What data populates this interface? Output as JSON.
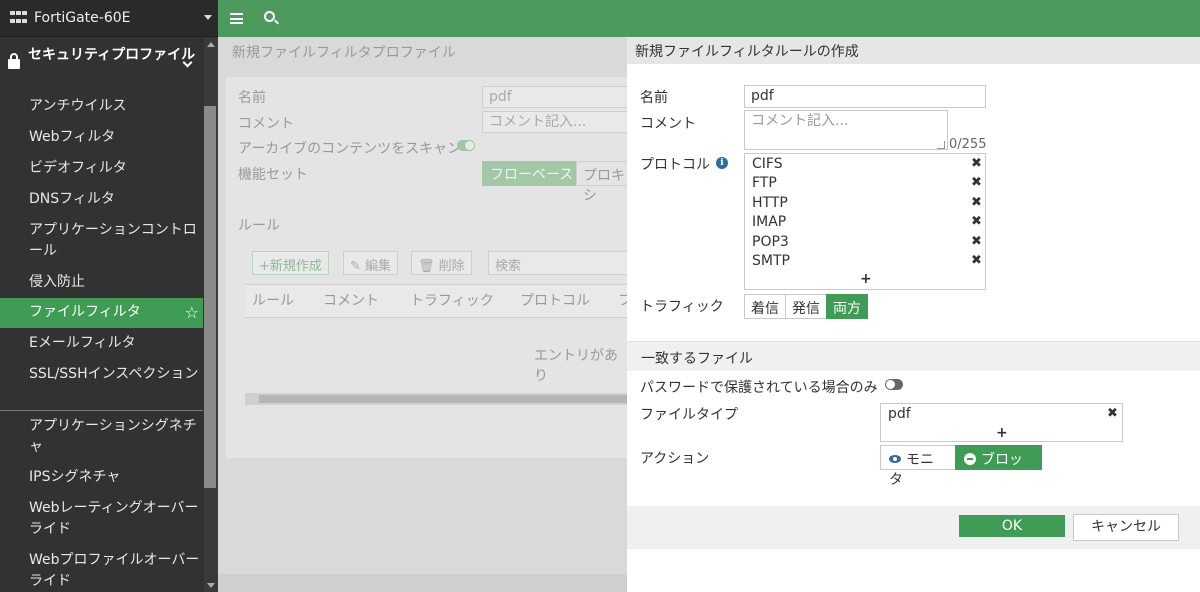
{
  "sidebar": {
    "device_name": "FortiGate-60E",
    "section_title": "セキュリティプロファイル",
    "items": [
      {
        "label": "アンチウイルス"
      },
      {
        "label": "Webフィルタ"
      },
      {
        "label": "ビデオフィルタ"
      },
      {
        "label": "DNSフィルタ"
      },
      {
        "label": "アプリケーションコントロール"
      },
      {
        "label": "侵入防止"
      },
      {
        "label": "ファイルフィルタ",
        "active": true
      },
      {
        "label": "Eメールフィルタ"
      },
      {
        "label": "SSL/SSHインスペクション"
      },
      {
        "label": "アプリケーションシグネチャ"
      },
      {
        "label": "IPSシグネチャ"
      },
      {
        "label": "Webレーティングオーバーライド"
      },
      {
        "label": "Webプロファイルオーバーライド"
      }
    ]
  },
  "topbar": {
    "menu_icon": "hamburger-icon",
    "search_icon": "search-icon"
  },
  "background_page": {
    "title": "新規ファイルフィルタプロファイル",
    "name_label": "名前",
    "name_value": "pdf",
    "comment_label": "コメント",
    "comment_placeholder": "コメント記入...",
    "archive_label": "アーカイブのコンテンツをスキャン",
    "feature_set_label": "機能セット",
    "feature_flow": "フローベース",
    "feature_proxy": "プロキシ",
    "rules_label": "ルール",
    "new_button": "+新規作成",
    "edit_button": "編集",
    "delete_button": "削除",
    "search_placeholder": "検索",
    "columns": [
      "ルール",
      "コメント",
      "トラフィック",
      "プロトコル",
      "フ"
    ],
    "empty_text": "エントリがあり"
  },
  "dialog": {
    "title": "新規ファイルフィルタルールの作成",
    "name_label": "名前",
    "name_value": "pdf",
    "comment_label": "コメント",
    "comment_placeholder": "コメント記入...",
    "comment_counter": "0/255",
    "protocol_label": "プロトコル",
    "protocols": [
      "CIFS",
      "FTP",
      "HTTP",
      "IMAP",
      "POP3",
      "SMTP"
    ],
    "add_symbol": "+",
    "remove_symbol": "✖",
    "traffic_label": "トラフィック",
    "traffic_options": [
      "着信",
      "発信",
      "両方"
    ],
    "traffic_selected": "両方",
    "match_section": "一致するファイル",
    "password_label": "パスワードで保護されている場合のみ",
    "filetype_label": "ファイルタイプ",
    "filetypes": [
      "pdf"
    ],
    "action_label": "アクション",
    "action_monitor": "モニタ",
    "action_block": "ブロック",
    "action_selected": "ブロック",
    "ok_label": "OK",
    "cancel_label": "キャンセル"
  },
  "colors": {
    "brand_green": "#3f9c55",
    "topbar_green": "#4d9a5d",
    "sidebar_bg": "#323232"
  }
}
